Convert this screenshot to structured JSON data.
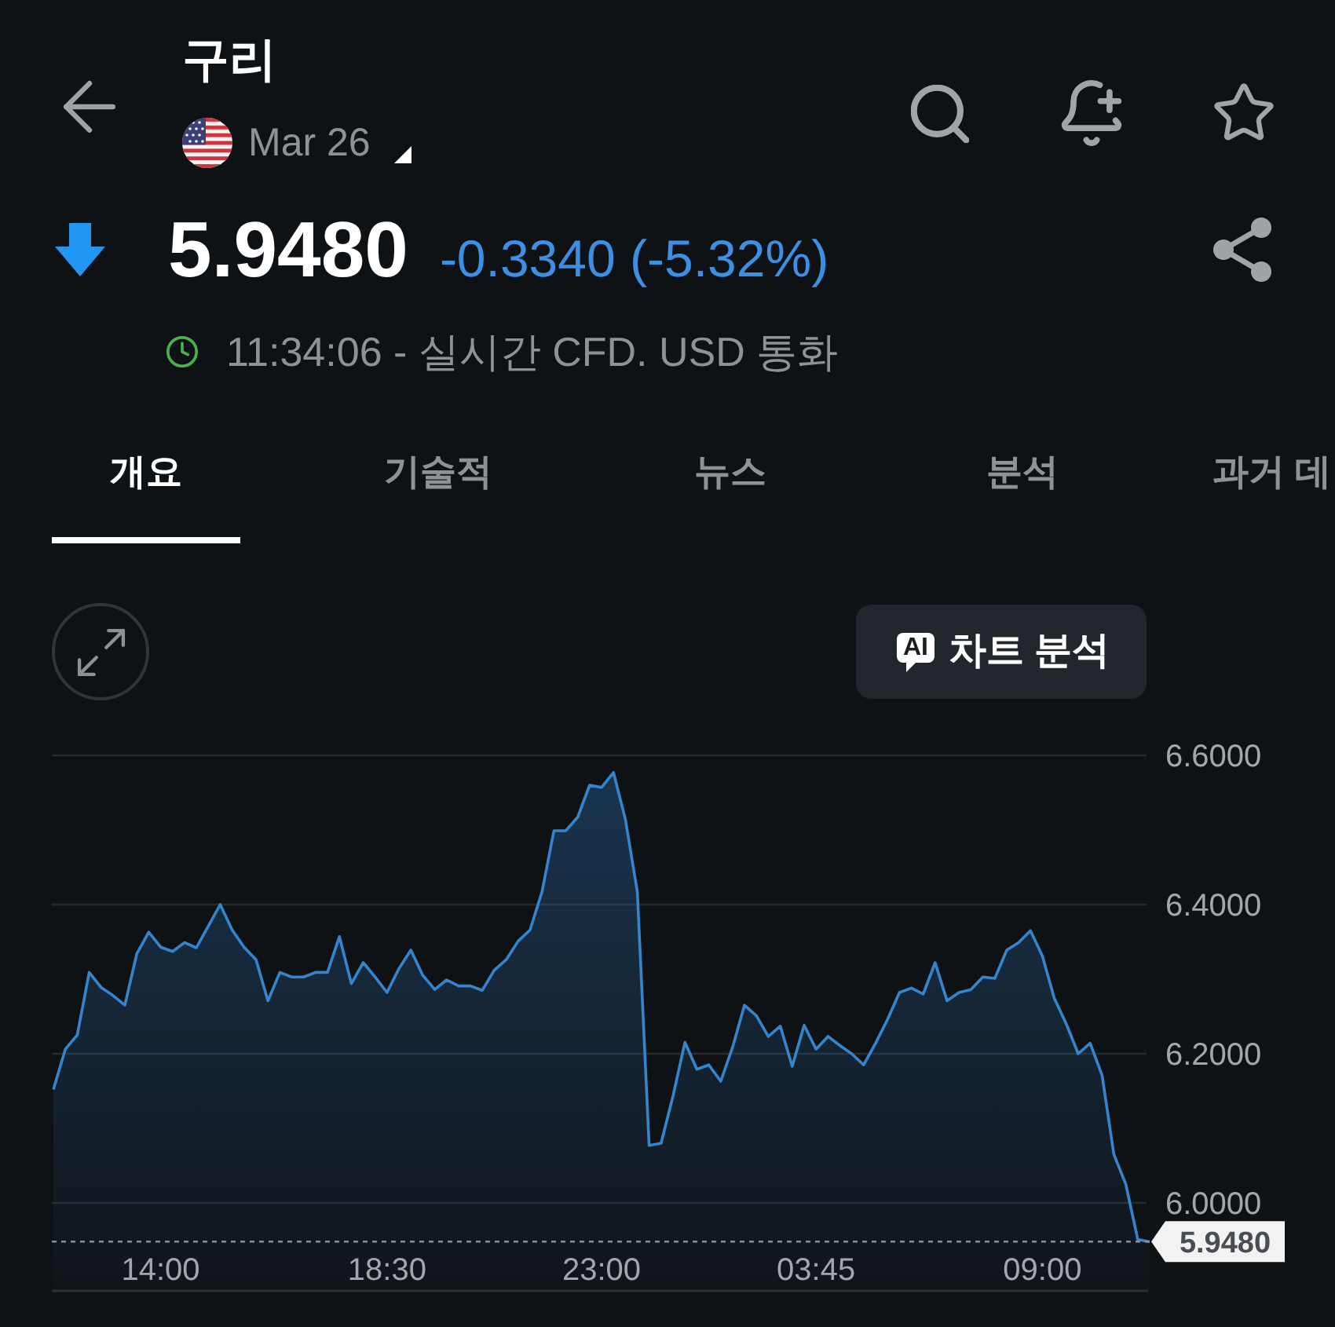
{
  "header": {
    "title": "구리",
    "contract": "Mar 26"
  },
  "quote": {
    "falling": true,
    "price": "5.9480",
    "change": "-0.3340 (-5.32%)",
    "market_open": true,
    "info": "11:34:06 - 실시간 CFD. USD 통화"
  },
  "tabs": [
    {
      "label": "개요",
      "selected": true
    },
    {
      "label": "기술적",
      "selected": false
    },
    {
      "label": "뉴스",
      "selected": false
    },
    {
      "label": "분석",
      "selected": false
    },
    {
      "label": "과거 데",
      "selected": false
    }
  ],
  "chart": {
    "ai_badge": "AI",
    "ai_button": "차트 분석",
    "chart_data": {
      "type": "area",
      "categories": [
        null,
        null,
        null,
        null,
        null,
        null,
        null,
        null,
        null,
        "14:00",
        null,
        null,
        null,
        null,
        null,
        null,
        null,
        null,
        null,
        null,
        null,
        null,
        null,
        null,
        null,
        null,
        null,
        null,
        "18:30",
        null,
        null,
        null,
        null,
        null,
        null,
        null,
        null,
        null,
        null,
        null,
        null,
        null,
        null,
        null,
        null,
        null,
        "23:00",
        null,
        null,
        null,
        null,
        null,
        null,
        null,
        null,
        null,
        null,
        null,
        null,
        null,
        null,
        null,
        null,
        null,
        "03:45",
        null,
        null,
        null,
        null,
        null,
        null,
        null,
        null,
        null,
        null,
        null,
        null,
        null,
        null,
        null,
        null,
        null,
        null,
        "09:00",
        null,
        null,
        null,
        null,
        null,
        null,
        null,
        null,
        null
      ],
      "values": [
        6.152,
        6.206,
        6.225,
        6.309,
        6.289,
        6.278,
        6.265,
        6.334,
        6.363,
        6.343,
        6.337,
        6.349,
        6.342,
        6.371,
        6.4,
        6.366,
        6.343,
        6.326,
        6.271,
        6.309,
        6.303,
        6.303,
        6.309,
        6.309,
        6.357,
        6.294,
        6.322,
        6.303,
        6.282,
        6.314,
        6.339,
        6.305,
        6.286,
        6.299,
        6.291,
        6.291,
        6.285,
        6.312,
        6.326,
        6.351,
        6.366,
        6.417,
        6.499,
        6.499,
        6.517,
        6.56,
        6.557,
        6.577,
        6.514,
        6.417,
        6.077,
        6.08,
        6.143,
        6.215,
        6.179,
        6.185,
        6.163,
        6.209,
        6.265,
        6.251,
        6.223,
        6.237,
        6.183,
        6.238,
        6.206,
        6.223,
        6.211,
        6.2,
        6.185,
        6.214,
        6.246,
        6.282,
        6.288,
        6.28,
        6.322,
        6.271,
        6.282,
        6.286,
        6.303,
        6.301,
        6.339,
        6.349,
        6.365,
        6.331,
        6.274,
        6.24,
        6.2,
        6.214,
        6.171,
        6.065,
        6.025,
        5.951,
        5.948
      ],
      "ylim": [
        5.882,
        6.6
      ],
      "yticks": [
        {
          "value": 6.0,
          "label": "6.0000"
        },
        {
          "value": 6.2,
          "label": "6.2000"
        },
        {
          "value": 6.4,
          "label": "6.4000"
        },
        {
          "value": 6.6,
          "label": "6.6000"
        }
      ],
      "grid": true,
      "ref_lines": [
        {
          "axis": "y",
          "value": 5.948,
          "label": "5.9480"
        }
      ]
    }
  }
}
